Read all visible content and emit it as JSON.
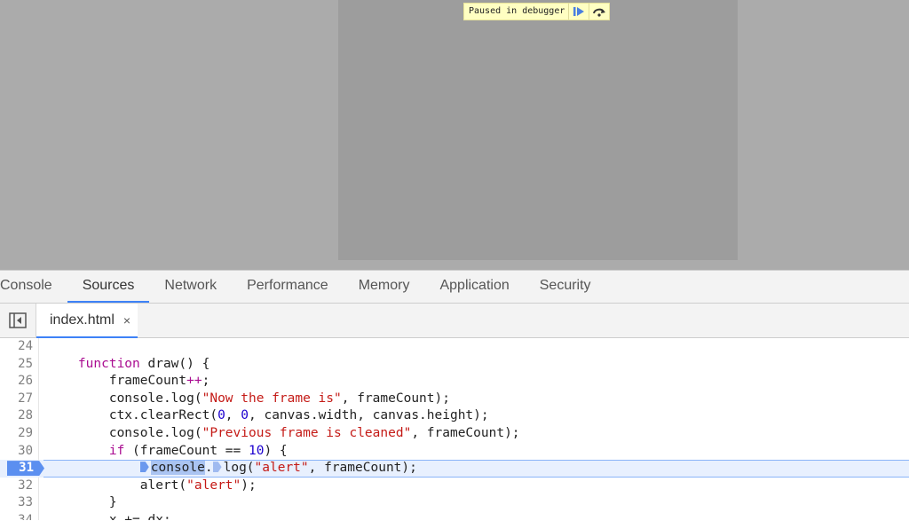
{
  "viewport": {
    "paused_label": "Paused in debugger",
    "resume_icon": "resume-icon",
    "step_over_icon": "step-over-icon"
  },
  "devtools": {
    "tabs": [
      {
        "label": "Console",
        "active": false
      },
      {
        "label": "Sources",
        "active": true
      },
      {
        "label": "Network",
        "active": false
      },
      {
        "label": "Performance",
        "active": false
      },
      {
        "label": "Memory",
        "active": false
      },
      {
        "label": "Application",
        "active": false
      },
      {
        "label": "Security",
        "active": false
      }
    ],
    "navigator_toggle_icon": "sidebar-toggle-icon",
    "open_file": {
      "name": "index.html",
      "close_symbol": "×"
    },
    "execution_line": 31,
    "code_lines": [
      {
        "num": "24",
        "text": ""
      },
      {
        "num": "25",
        "kw": "function",
        "rest": " draw() {",
        "indent": "    "
      },
      {
        "num": "26",
        "indent": "        ",
        "text": "frameCount",
        "op": "++",
        "tail": ";"
      },
      {
        "num": "27",
        "indent": "        ",
        "text": "console.log(",
        "str": "\"Now the frame is\"",
        "tail": ", frameCount);"
      },
      {
        "num": "28",
        "indent": "        ",
        "text": "ctx.clearRect(",
        "n1": "0",
        "mid": ", ",
        "n2": "0",
        "tail": ", canvas.width, canvas.height);"
      },
      {
        "num": "29",
        "indent": "        ",
        "text": "console.log(",
        "str": "\"Previous frame is cleaned\"",
        "tail": ", frameCount);"
      },
      {
        "num": "30",
        "indent": "        ",
        "kw": "if",
        "text": " (frameCount == ",
        "n1": "10",
        "tail": ") {"
      },
      {
        "num": "31",
        "indent": "            ",
        "sel": "console",
        "text": ".",
        "text2": "log(",
        "str": "\"alert\"",
        "tail": ", frameCount);"
      },
      {
        "num": "32",
        "indent": "            ",
        "text": "alert(",
        "str": "\"alert\"",
        "tail": ");"
      },
      {
        "num": "33",
        "indent": "        ",
        "text": "}"
      },
      {
        "num": "34",
        "indent": "        ",
        "text": "x += dx;"
      }
    ]
  },
  "colors": {
    "accent": "#3e82f7",
    "execution_marker": "#5b8ff0",
    "paused_bar": "#ffffc2",
    "keyword": "#aa0d91",
    "string": "#c41a16",
    "number": "#1c00cf"
  }
}
